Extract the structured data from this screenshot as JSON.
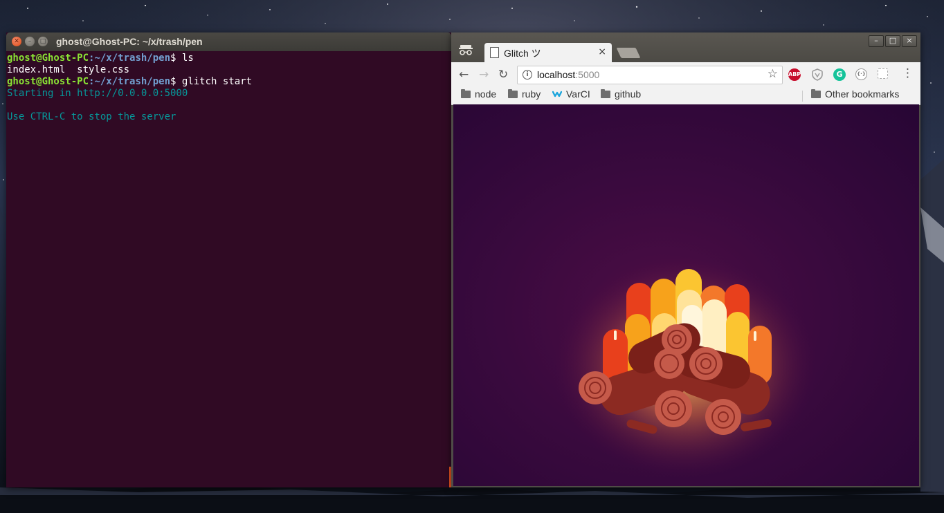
{
  "terminal": {
    "title": "ghost@Ghost-PC: ~/x/trash/pen",
    "lines": [
      {
        "user": "ghost@Ghost-PC",
        "sep": ":",
        "path": "~/x/trash/pen",
        "prompt": "$",
        "cmd": " ls"
      },
      {
        "text": "index.html  style.css"
      },
      {
        "user": "ghost@Ghost-PC",
        "sep": ":",
        "path": "~/x/trash/pen",
        "prompt": "$",
        "cmd": " glitch start"
      },
      {
        "text": "Starting in http://0.0.0.0:5000"
      },
      {
        "text": ""
      },
      {
        "text": "Use CTRL-C to stop the server"
      }
    ]
  },
  "browser": {
    "tab_title": "Glitch ツ",
    "tab_close": "×",
    "url_host": "localhost",
    "url_port": ":5000",
    "info_icon": "i",
    "back_icon": "←",
    "forward_icon": "→",
    "reload_icon": "↻",
    "star_icon": "☆",
    "menu_icon": "⋮",
    "extensions": [
      {
        "name": "abp-icon",
        "label": "ABP",
        "color": "#c70d2c"
      },
      {
        "name": "shield-icon",
        "label": "",
        "color": "#9a9a9a"
      },
      {
        "name": "grammarly-icon",
        "label": "G",
        "color": "#15c39a"
      },
      {
        "name": "json-viewer-icon",
        "label": "{·}",
        "color": "#9a9a9a"
      },
      {
        "name": "screenshot-icon",
        "label": "",
        "color": "#b8b8b8"
      }
    ],
    "bookmarks": [
      "node",
      "ruby",
      "VarCI",
      "github"
    ],
    "other_bookmarks": "Other bookmarks",
    "window_controls": [
      "–",
      "□",
      "×"
    ]
  },
  "colors": {
    "terminal_bg": "#300a24",
    "prompt_user": "#8ae234",
    "prompt_path": "#729fcf",
    "output_cyan": "#06989a",
    "page_bg": "#3a0a3e"
  }
}
